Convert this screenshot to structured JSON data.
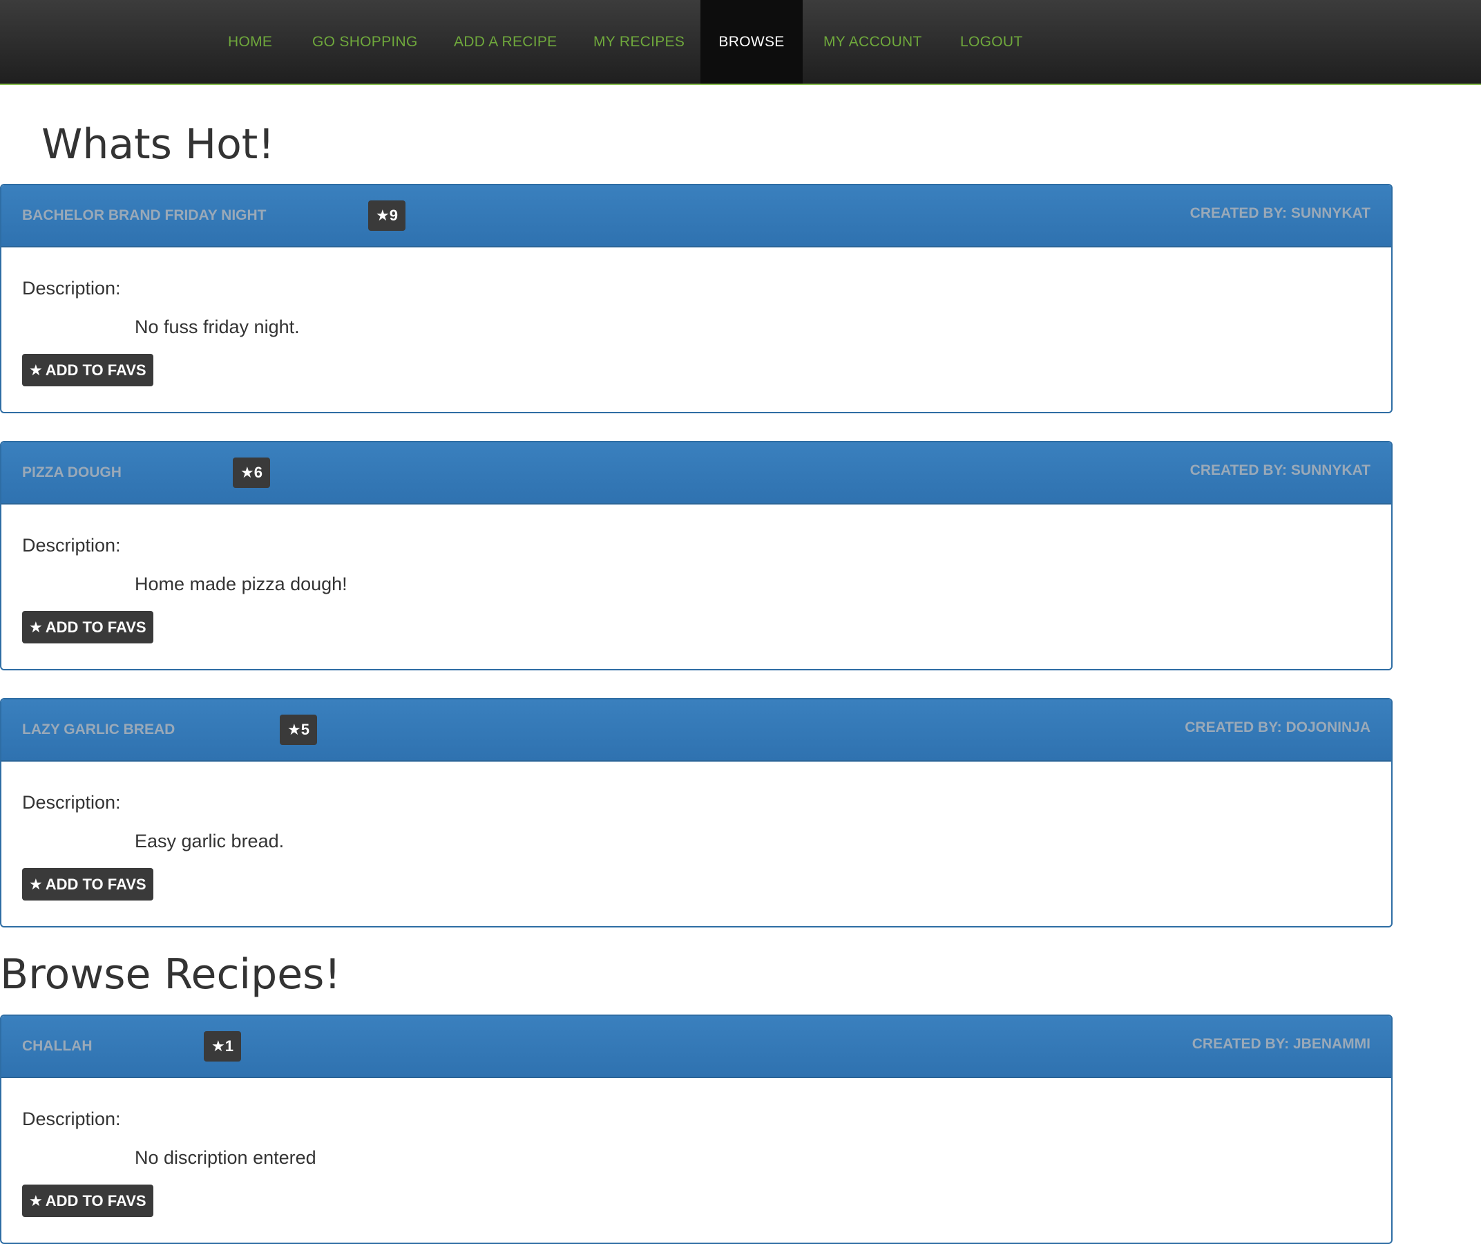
{
  "nav": {
    "items": [
      {
        "label": "HOME",
        "active": false
      },
      {
        "label": "GO SHOPPING",
        "active": false
      },
      {
        "label": "ADD A RECIPE",
        "active": false
      },
      {
        "label": "MY RECIPES",
        "active": false
      },
      {
        "label": "BROWSE",
        "active": true
      },
      {
        "label": "MY ACCOUNT",
        "active": false
      },
      {
        "label": "LOGOUT",
        "active": false
      }
    ]
  },
  "hot": {
    "title": "Whats Hot!",
    "recipes": [
      {
        "name": "BACHELOR BRAND FRIDAY NIGHT",
        "favs": "9",
        "created_by": "CREATED BY: SUNNYKAT",
        "description_label": "Description:",
        "description": "No fuss friday night.",
        "button_label": "ADD TO FAVS"
      },
      {
        "name": "PIZZA DOUGH",
        "favs": "6",
        "created_by": "CREATED BY: SUNNYKAT",
        "description_label": "Description:",
        "description": "Home made pizza dough!",
        "button_label": "ADD TO FAVS"
      },
      {
        "name": "LAZY GARLIC BREAD",
        "favs": "5",
        "created_by": "CREATED BY: DOJONINJA",
        "description_label": "Description:",
        "description": "Easy garlic bread.",
        "button_label": "ADD TO FAVS"
      }
    ]
  },
  "browse": {
    "title": "Browse Recipes!",
    "recipes": [
      {
        "name": "CHALLAH",
        "favs": "1",
        "created_by": "CREATED BY: JBENAMMI",
        "description_label": "Description:",
        "description": "No discription entered",
        "button_label": "ADD TO FAVS"
      }
    ]
  },
  "icons": {
    "star": "star-icon"
  },
  "colors": {
    "nav_link": "#6fa83c",
    "nav_active_bg": "#0d0d0d",
    "panel_heading": "#337ab7",
    "badge_bg": "#3a3a3a"
  }
}
